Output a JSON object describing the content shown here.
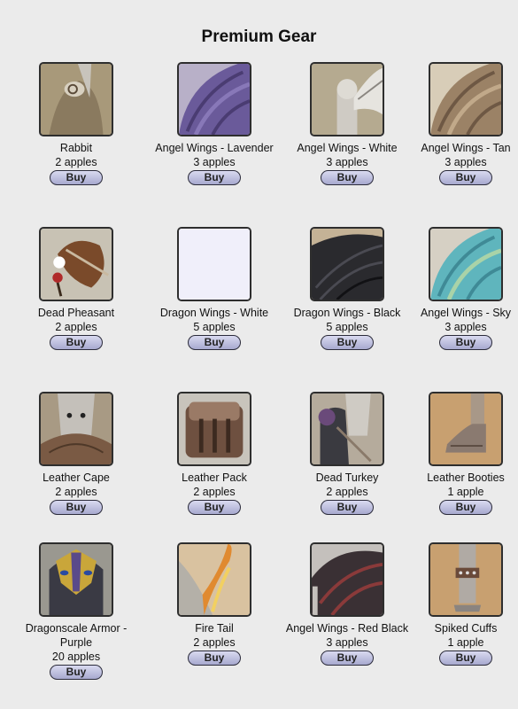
{
  "page": {
    "title": "Premium Gear",
    "buy_label": "Buy"
  },
  "items": [
    {
      "name": "Rabbit",
      "price": "2 apples",
      "icon": "rabbit-thumbnail",
      "colors": [
        "#8a7a5f",
        "#a8997a",
        "#6d5a3e"
      ]
    },
    {
      "name": "Angel Wings - Lavender",
      "price": "3 apples",
      "icon": "lavender-wings-thumbnail",
      "colors": [
        "#6a5a9a",
        "#8878b8",
        "#4a3c72"
      ]
    },
    {
      "name": "Angel Wings - White",
      "price": "3 apples",
      "icon": "white-wings-thumbnail",
      "colors": [
        "#c9c6c0",
        "#e6e4df",
        "#8a8680"
      ]
    },
    {
      "name": "Angel Wings - Tan",
      "price": "3 apples",
      "icon": "tan-wings-thumbnail",
      "colors": [
        "#9b8266",
        "#c1a98a",
        "#6e5844"
      ]
    },
    {
      "name": "Dead Pheasant",
      "price": "2 apples",
      "icon": "pheasant-thumbnail",
      "colors": [
        "#7a4a2a",
        "#c9b9a0",
        "#3a2a1c"
      ]
    },
    {
      "name": "Dragon Wings - White",
      "price": "5 apples",
      "icon": "white-dragon-wings-thumbnail",
      "colors": [
        "#f0effa",
        "#f0effa",
        "#f0effa"
      ]
    },
    {
      "name": "Dragon Wings - Black",
      "price": "5 apples",
      "icon": "black-dragon-wings-thumbnail",
      "colors": [
        "#2a2a2e",
        "#4a4a52",
        "#111114"
      ]
    },
    {
      "name": "Angel Wings - Sky",
      "price": "3 apples",
      "icon": "sky-wings-thumbnail",
      "colors": [
        "#5fb5bd",
        "#a9d3a8",
        "#3f8a96"
      ]
    },
    {
      "name": "Leather Cape",
      "price": "2 apples",
      "icon": "leather-cape-thumbnail",
      "colors": [
        "#7a5a44",
        "#c4c0ba",
        "#4e3828"
      ]
    },
    {
      "name": "Leather Pack",
      "price": "2 apples",
      "icon": "leather-pack-thumbnail",
      "colors": [
        "#6e5040",
        "#9a7a66",
        "#3c2a20"
      ]
    },
    {
      "name": "Dead Turkey",
      "price": "2 apples",
      "icon": "turkey-thumbnail",
      "colors": [
        "#3a3a40",
        "#8a7a6a",
        "#6a4a7a"
      ]
    },
    {
      "name": "Leather Booties",
      "price": "1 apple",
      "icon": "leather-booties-thumbnail",
      "colors": [
        "#c8a070",
        "#8a7a70",
        "#a89888"
      ]
    },
    {
      "name": "Dragonscale Armor - Purple",
      "price": "20 apples",
      "icon": "dragonscale-armor-thumbnail",
      "colors": [
        "#c9a63a",
        "#5a4a8a",
        "#3a3a44"
      ]
    },
    {
      "name": "Fire Tail",
      "price": "2 apples",
      "icon": "fire-tail-thumbnail",
      "colors": [
        "#d9c2a0",
        "#e08a30",
        "#f2d060"
      ]
    },
    {
      "name": "Angel Wings - Red Black",
      "price": "3 apples",
      "icon": "red-black-wings-thumbnail",
      "colors": [
        "#3a3034",
        "#8a3a3a",
        "#c4c0bc"
      ]
    },
    {
      "name": "Spiked Cuffs",
      "price": "1 apple",
      "icon": "spiked-cuffs-thumbnail",
      "colors": [
        "#c8a070",
        "#b0aaa4",
        "#6a4a3a"
      ]
    }
  ]
}
